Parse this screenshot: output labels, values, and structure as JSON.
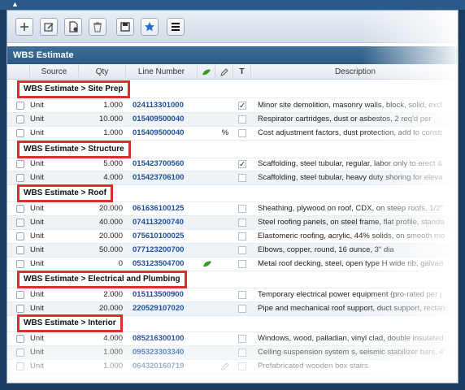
{
  "toolbar": {
    "buttons": [
      {
        "icon": "plus-icon"
      },
      {
        "icon": "edit-icon"
      },
      {
        "icon": "document-icon"
      },
      {
        "icon": "trash-icon"
      },
      {
        "icon": "save-icon"
      },
      {
        "icon": "star-icon"
      },
      {
        "icon": "menu-icon"
      }
    ]
  },
  "panel": {
    "title": "WBS Estimate"
  },
  "columns": {
    "source": "Source",
    "qty": "Qty",
    "line_number": "Line Number",
    "t": "T",
    "description": "Description"
  },
  "groups": [
    {
      "label": "WBS Estimate > Site Prep"
    },
    {
      "label": "WBS Estimate > Structure"
    },
    {
      "label": "WBS Estimate > Roof"
    },
    {
      "label": "WBS Estimate > Electrical and Plumbing"
    },
    {
      "label": "WBS Estimate > Interior"
    }
  ],
  "rows": [
    {
      "source": "Unit",
      "qty": "1.000",
      "line": "024113301000",
      "desc": "Minor site demolition, masonry walls, block, solid, excl",
      "t_checked": true,
      "icon": ""
    },
    {
      "source": "Unit",
      "qty": "10.000",
      "line": "015409500040",
      "desc": "Respirator cartridges, dust or asbestos, 2 req'd per",
      "t_checked": false,
      "icon": ""
    },
    {
      "source": "Unit",
      "qty": "1.000",
      "line": "015409500040",
      "desc": "Cost adjustment factors, dust protection, add to constr",
      "t_checked": false,
      "icon": "%"
    },
    {
      "source": "Unit",
      "qty": "5.000",
      "line": "015423700560",
      "desc": "Scaffolding, steel tubular, regular, labor only to erect &",
      "t_checked": true,
      "icon": ""
    },
    {
      "source": "Unit",
      "qty": "4.000",
      "line": "015423706100",
      "desc": "Scaffolding, steel tubular, heavy duty shoring for eleva",
      "t_checked": false,
      "icon": ""
    },
    {
      "source": "Unit",
      "qty": "20.000",
      "line": "061636100125",
      "desc": "Sheathing, plywood on roof, CDX, on steep roofs, 1/2\"",
      "t_checked": false,
      "icon": ""
    },
    {
      "source": "Unit",
      "qty": "40.000",
      "line": "074113200740",
      "desc": "Steel roofing panels, on steel frame, flat profile, standa",
      "t_checked": false,
      "icon": ""
    },
    {
      "source": "Unit",
      "qty": "20.000",
      "line": "075610100025",
      "desc": "Elastomeric roofing, acrylic, 44% solids, on smooth mo",
      "t_checked": false,
      "icon": ""
    },
    {
      "source": "Unit",
      "qty": "50.000",
      "line": "077123200700",
      "desc": "Elbows, copper, round, 16 ounce, 3\" dia",
      "t_checked": false,
      "icon": ""
    },
    {
      "source": "Unit",
      "qty": "0",
      "line": "053123504700",
      "desc": "Metal roof decking, steel, open type H wide rib, galvan",
      "t_checked": false,
      "icon": "leaf"
    },
    {
      "source": "Unit",
      "qty": "2.000",
      "line": "015113500900",
      "desc": "Temporary electrical power equipment (pro-rated per j",
      "t_checked": false,
      "icon": ""
    },
    {
      "source": "Unit",
      "qty": "20.000",
      "line": "220529107020",
      "desc": "Pipe and mechanical roof support, duct support, rectan",
      "t_checked": false,
      "icon": ""
    },
    {
      "source": "Unit",
      "qty": "4.000",
      "line": "085216300100",
      "desc": "Windows, wood, palladian, vinyl clad, double insulated",
      "t_checked": false,
      "icon": ""
    },
    {
      "source": "Unit",
      "qty": "1.000",
      "line": "095323303340",
      "desc": "Ceiling suspension system s, seismic stabilizer bars, 4'",
      "t_checked": false,
      "icon": ""
    },
    {
      "source": "Unit",
      "qty": "1.000",
      "line": "064320160719",
      "desc": "Prefabricated wooden box stairs",
      "t_checked": false,
      "icon": "pencil"
    }
  ]
}
